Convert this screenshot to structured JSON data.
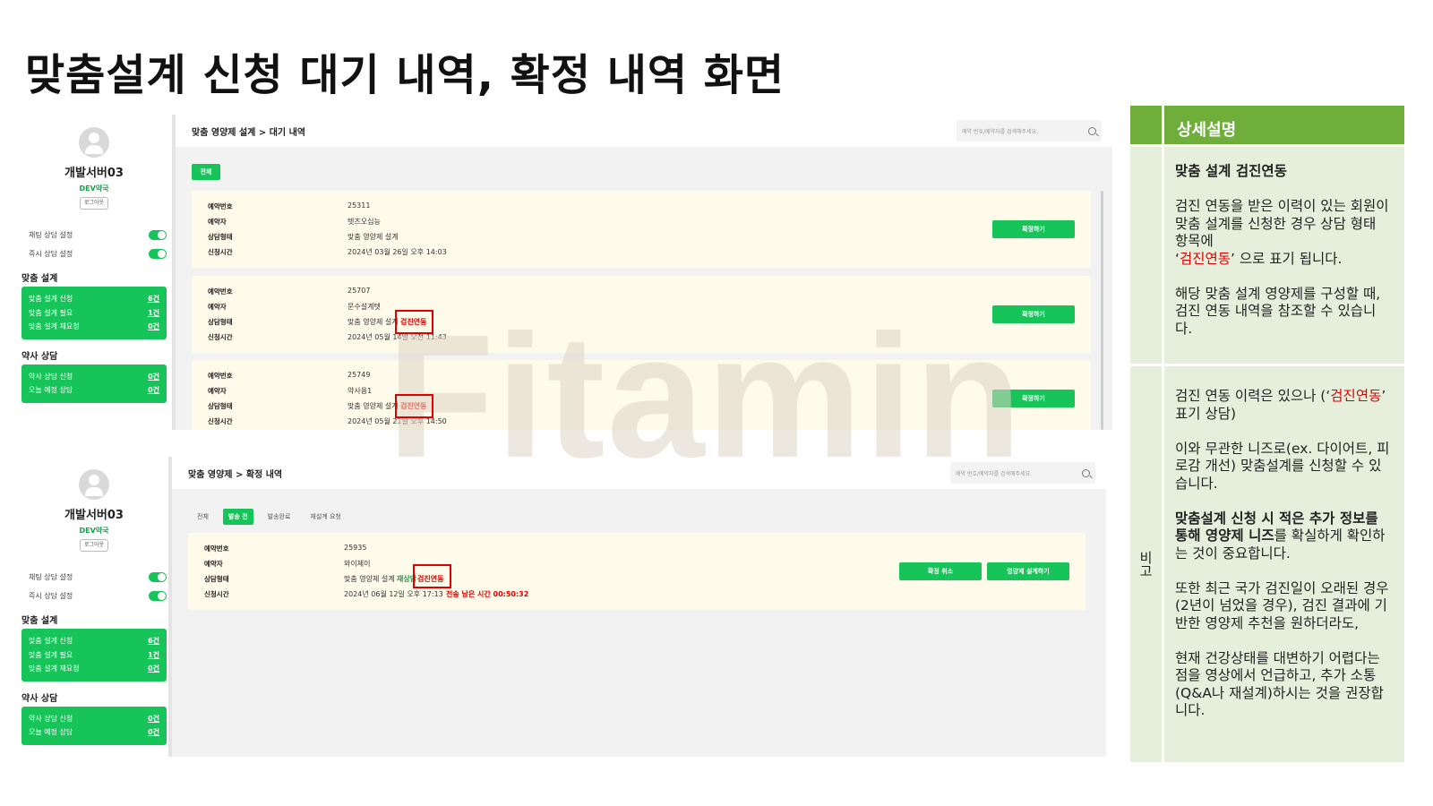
{
  "title": "맞춤설계 신청 대기 내역, 확정 내역 화면",
  "watermark": "Fitamin",
  "sidebar": {
    "user_name": "개발서버03",
    "pharmacy": "DEV약국",
    "logout": "로그아웃",
    "toggles": [
      {
        "label": "채팅 상담 설정",
        "on": true
      },
      {
        "label": "즉시 상담 설정",
        "on": true
      }
    ],
    "sections": [
      {
        "title": "맞춤 설계",
        "items": [
          {
            "label": "맞춤 설계 신청",
            "count": "6건"
          },
          {
            "label": "맞춤 설계 필요",
            "count": "1건"
          },
          {
            "label": "맞춤 설계 재요청",
            "count": "0건"
          }
        ]
      },
      {
        "title": "약사 상담",
        "items": [
          {
            "label": "약사 상담 신청",
            "count": "0건"
          },
          {
            "label": "오늘 예정 상담",
            "count": "0건"
          }
        ]
      }
    ]
  },
  "pending": {
    "breadcrumb": "맞춤 영양제 설계 > 대기 내역",
    "search_placeholder": "예약 번호/예약자를 검색해주세요.",
    "filter_all": "전체",
    "labels": {
      "id": "예약번호",
      "name": "예약자",
      "type": "상담형태",
      "time": "신청시간"
    },
    "confirm_label": "확정하기",
    "items": [
      {
        "id": "25311",
        "name": "텟츠오십능",
        "type": "맞춤 영양제 설계",
        "tag": "",
        "time": "2024년 03월 26일 오후 14:03"
      },
      {
        "id": "25707",
        "name": "문수설계텟",
        "type": "맞춤 영양제 설계",
        "tag": "검진연동",
        "time": "2024년 05월 14일 오전 11:43"
      },
      {
        "id": "25749",
        "name": "약사용1",
        "type": "맞춤 영양제 설계",
        "tag": "검진연동",
        "time": "2024년 05월 21일 오후 14:50"
      }
    ]
  },
  "confirmed": {
    "breadcrumb": "맞춤 영양제 > 확정 내역",
    "search_placeholder": "예약 번호/예약자를 검색해주세요.",
    "tabs": [
      {
        "label": "전체",
        "active": false
      },
      {
        "label": "발송 전",
        "active": true
      },
      {
        "label": "발송완료",
        "active": false
      },
      {
        "label": "재설계 요청",
        "active": false
      }
    ],
    "labels": {
      "id": "예약번호",
      "name": "예약자",
      "type": "상담형태",
      "time": "신청시간"
    },
    "item": {
      "id": "25935",
      "name": "와이제이",
      "type": "맞춤 영양제 설계",
      "redesign_tag": "재상담",
      "tag": "검진연동",
      "time": "2024년 06월 12일 오후 17:13",
      "remaining": "전송 남은 시간 00:50:32"
    },
    "cancel_label": "확정 취소",
    "design_label": "영양제 설계하기"
  },
  "panel": {
    "header": "상세설명",
    "note_label": "비고",
    "section1": {
      "heading": "맞춤 설계 검진연동",
      "p1": "검진 연동을 받은 이력이 있는 회원이 맞춤 설계를 신청한 경우 상담 형태 항목에",
      "p1_quote_open": "‘",
      "p1_red": "검진연동",
      "p1_tail": "’ 으로 표기 됩니다.",
      "p2": "해당 맞춤 설계 영양제를 구성할 때, 검진 연동 내역을 참조할 수 있습니다."
    },
    "section2": {
      "p1_pre": "검진 연동 이력은 있으나 (‘",
      "p1_red": "검진연동",
      "p1_post": "’ 표기 상담)",
      "p2": "이와 무관한 니즈로(ex. 다이어트, 피로감 개선) 맞춤설계를 신청할 수 있습니다.",
      "p3_bold": "맞춤설계 신청 시 적은 추가 정보를 통해 영양제 니즈",
      "p3_rest": "를 확실하게 확인하는 것이 중요합니다.",
      "p4": "또한 최근 국가 검진일이 오래된 경우 (2년이 넘었을 경우), 검진 결과에 기반한 영양제 추천을 원하더라도,",
      "p5": "현재 건강상태를 대변하기 어렵다는 점을 영상에서 언급하고, 추가 소통(Q&A나 재설계)하시는 것을 권장합니다."
    }
  }
}
